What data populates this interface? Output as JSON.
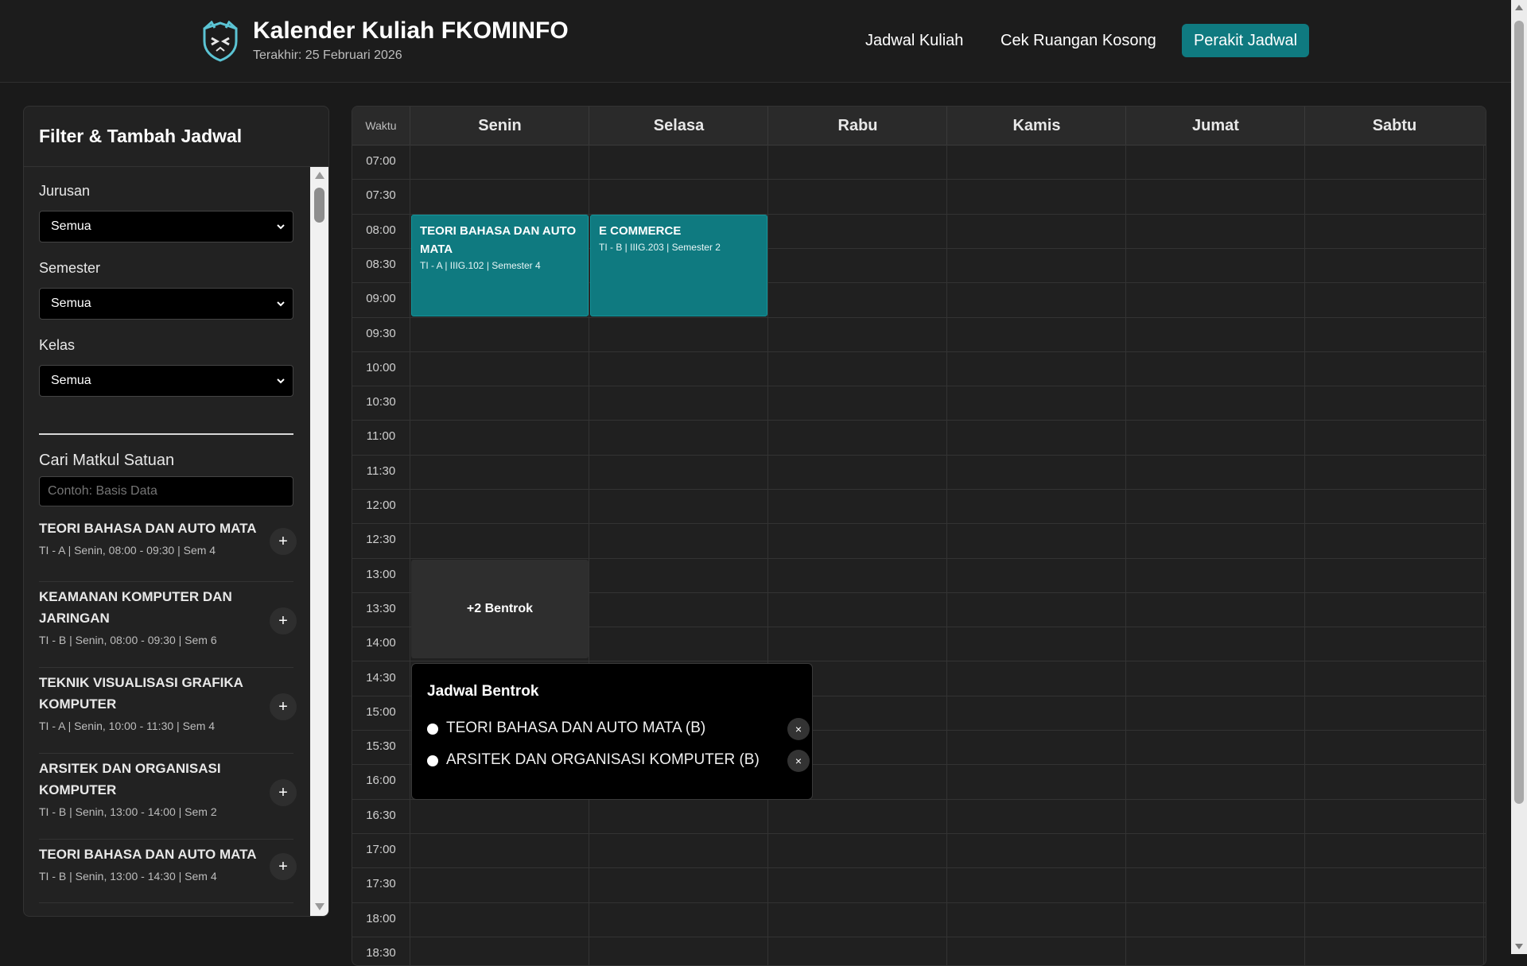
{
  "header": {
    "title": "Kalender Kuliah FKOMINFO",
    "subtitle": "Terakhir: 25 Februari 2026",
    "nav": [
      "Jadwal Kuliah",
      "Cek Ruangan Kosong",
      "Perakit Jadwal"
    ],
    "active_nav": "Perakit Jadwal"
  },
  "colors": {
    "accent": "#0f7a80",
    "background": "#1a1a1a",
    "panel": "#222222"
  },
  "sidebar": {
    "title": "Filter & Tambah Jadwal",
    "filters": [
      {
        "label": "Jurusan",
        "value": "Semua"
      },
      {
        "label": "Semester",
        "value": "Semua"
      },
      {
        "label": "Kelas",
        "value": "Semua"
      }
    ],
    "search_label": "Cari Matkul Satuan",
    "search_placeholder": "Contoh: Basis Data",
    "add_label": "+",
    "courses": [
      {
        "name": "TEORI BAHASA DAN AUTO MATA",
        "meta": "TI - A | Senin, 08:00 - 09:30 | Sem 4"
      },
      {
        "name": "KEAMANAN KOMPUTER DAN JARINGAN",
        "meta": "TI - B | Senin, 08:00 - 09:30 | Sem 6"
      },
      {
        "name": "TEKNIK VISUALISASI GRAFIKA KOMPUTER",
        "meta": "TI - A | Senin, 10:00 - 11:30 | Sem 4"
      },
      {
        "name": "ARSITEK DAN ORGANISASI KOMPUTER",
        "meta": "TI - B | Senin, 13:00 - 14:00 | Sem 2"
      },
      {
        "name": "TEORI BAHASA DAN AUTO MATA",
        "meta": "TI - B | Senin, 13:00 - 14:30 | Sem 4"
      }
    ]
  },
  "calendar": {
    "time_header": "Waktu",
    "days": [
      "Senin",
      "Selasa",
      "Rabu",
      "Kamis",
      "Jumat",
      "Sabtu"
    ],
    "times": [
      "07:00",
      "07:30",
      "08:00",
      "08:30",
      "09:00",
      "09:30",
      "10:00",
      "10:30",
      "11:00",
      "11:30",
      "12:00",
      "12:30",
      "13:00",
      "13:30",
      "14:00",
      "14:30",
      "15:00",
      "15:30",
      "16:00",
      "16:30",
      "17:00",
      "17:30",
      "18:00",
      "18:30"
    ],
    "events": [
      {
        "title": "TEORI BAHASA DAN AUTO MATA",
        "meta": "TI - A | IIIG.102 | Semester 4",
        "day": "Senin",
        "start": "08:00",
        "end": "09:30"
      },
      {
        "title": "E COMMERCE",
        "meta": "TI - B | IIIG.203 | Semester 2",
        "day": "Selasa",
        "start": "08:00",
        "end": "09:30"
      }
    ],
    "conflict_label": "+2 Bentrok"
  },
  "popup": {
    "title": "Jadwal Bentrok",
    "close_icon": "×",
    "items": [
      "TEORI BAHASA DAN AUTO MATA (B)",
      "ARSITEK DAN ORGANISASI KOMPUTER (B)"
    ]
  }
}
